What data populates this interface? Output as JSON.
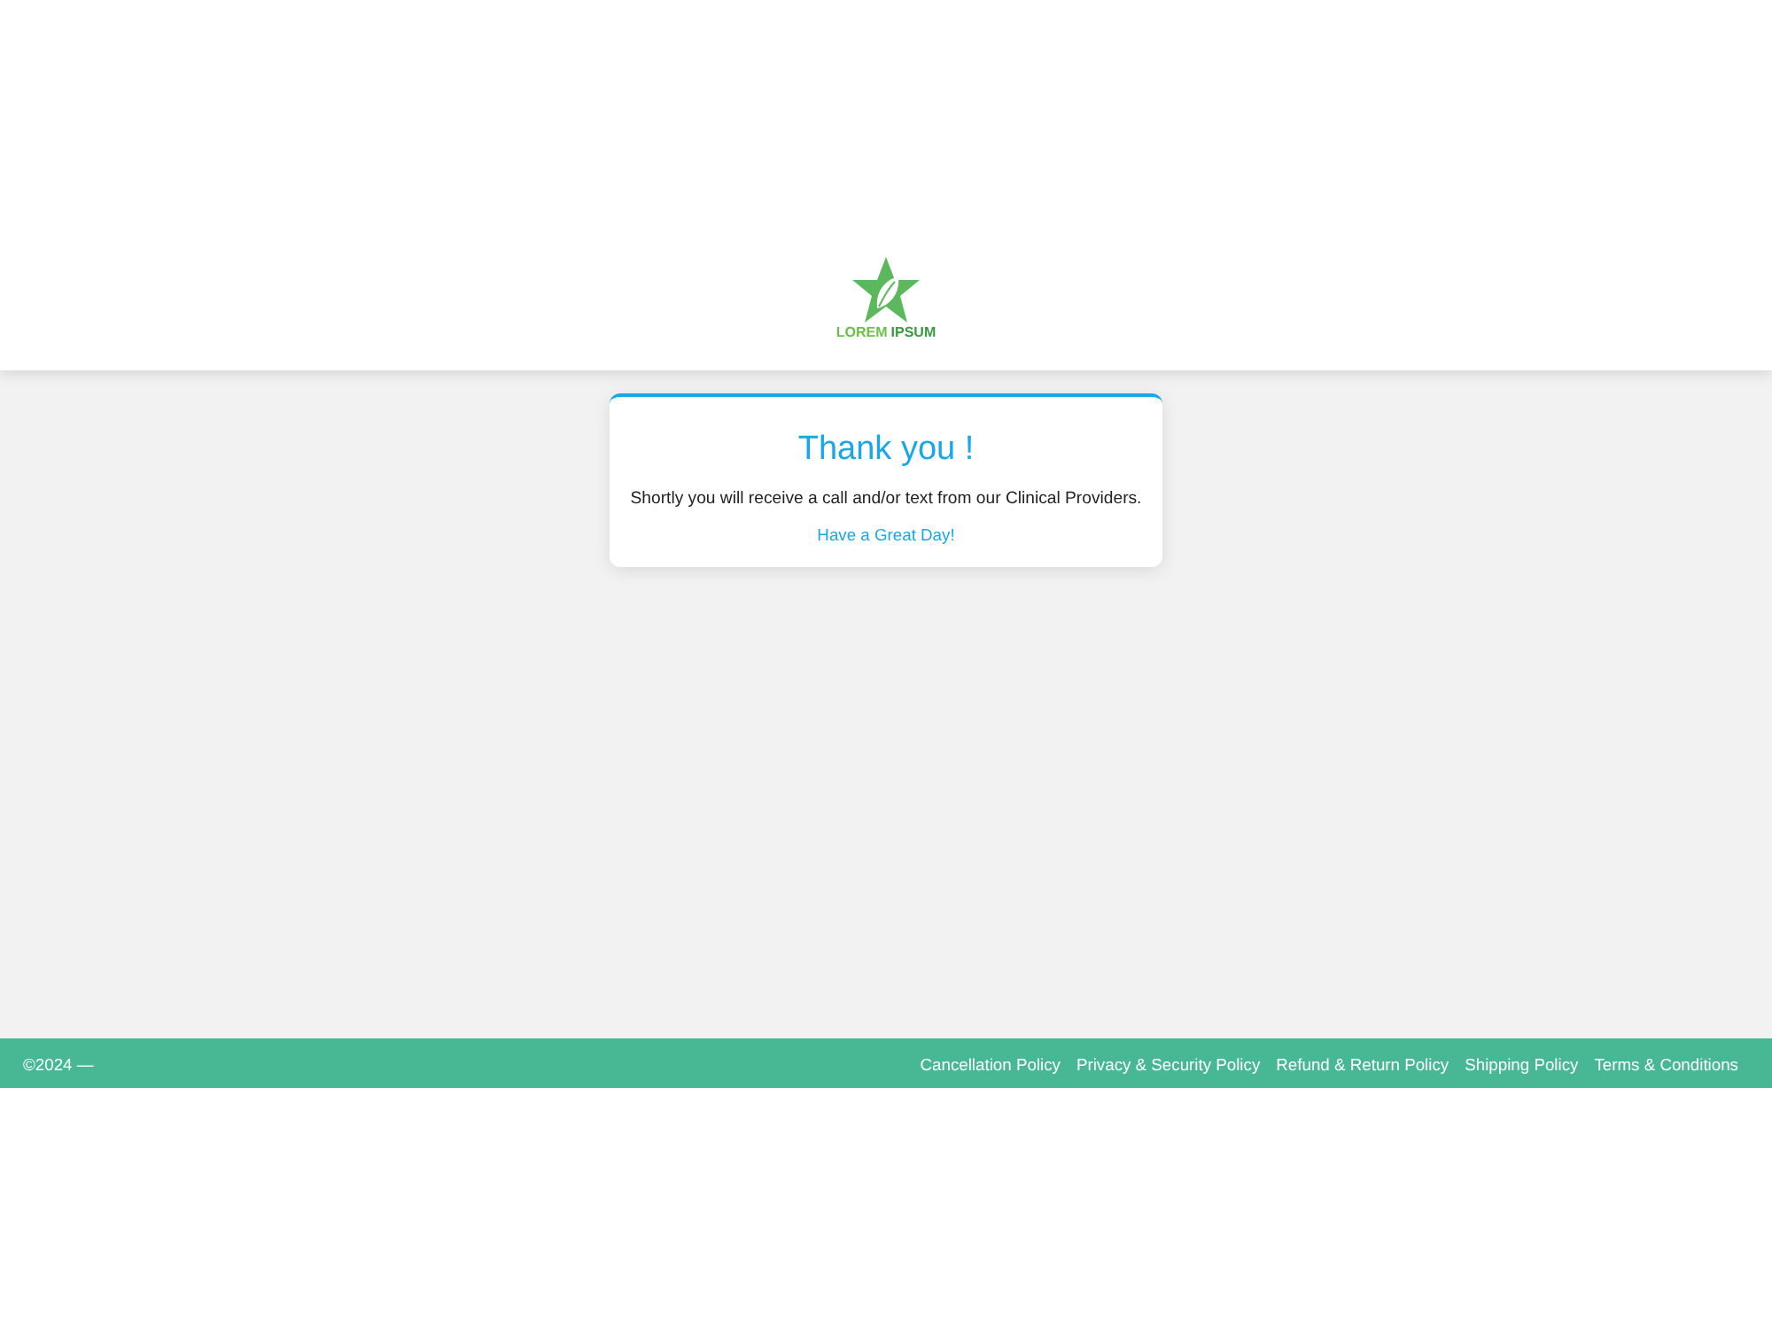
{
  "header": {
    "logo": {
      "words": [
        {
          "text": "LOREM",
          "color": "#6cc04a"
        },
        {
          "text": "IPSUM",
          "color": "#3a9a3e"
        }
      ]
    }
  },
  "card": {
    "title": "Thank you !",
    "message": "Shortly you will receive a call and/or text from our Clinical Providers.",
    "closing": "Have a Great Day!"
  },
  "footer": {
    "copyright": "©2024 —",
    "links": [
      "Cancellation Policy",
      "Privacy & Security Policy",
      "Refund & Return Policy",
      "Shipping Policy",
      "Terms & Conditions"
    ]
  }
}
